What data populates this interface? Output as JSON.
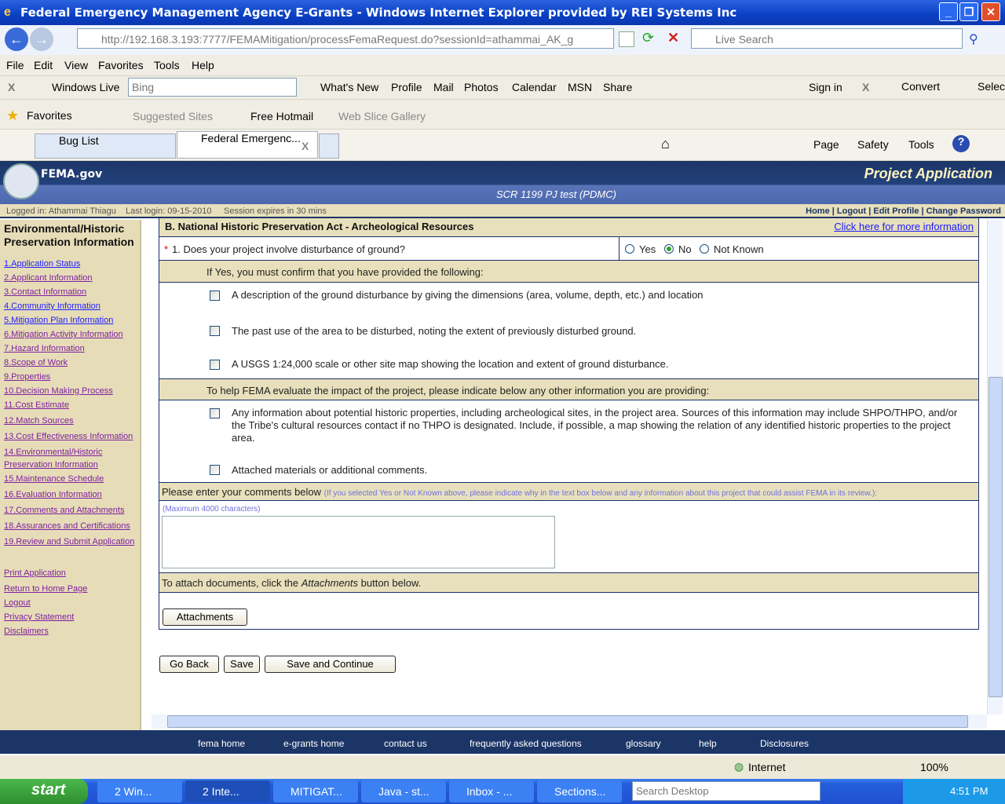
{
  "window": {
    "title": "Federal Emergency Management Agency E-Grants - Windows Internet Explorer provided by REI Systems Inc"
  },
  "address": {
    "url": "http://192.168.3.193:7777/FEMAMitigation/processFemaRequest.do?sessionId=athammai_AK_g",
    "search_placeholder": "Live Search"
  },
  "menu": [
    "File",
    "Edit",
    "View",
    "Favorites",
    "Tools",
    "Help"
  ],
  "live_toolbar": {
    "brand": "Windows Live",
    "search_placeholder": "Bing",
    "items": [
      "What's New",
      "Profile",
      "Mail",
      "Photos",
      "Calendar",
      "MSN",
      "Share"
    ],
    "sign_in": "Sign in",
    "convert": "Convert",
    "select": "Selec"
  },
  "favorites_bar": {
    "favorites": "Favorites",
    "items": [
      "Suggested Sites",
      "Free Hotmail",
      "Web Slice Gallery"
    ]
  },
  "tabs": [
    {
      "label": "Bug List"
    },
    {
      "label": "Federal Emergenc..."
    }
  ],
  "command_bar": [
    "Page",
    "Safety",
    "Tools"
  ],
  "site": {
    "logo": "FEMA.gov",
    "app_title": "Project Application",
    "subtitle": "SCR 1199 PJ test (PDMC)",
    "login": "Logged in: Athammai Thiagu",
    "last_login": "Last login: 09-15-2010",
    "session": "Session expires in 30 mins",
    "top_links": [
      "Home",
      "Logout",
      "Edit Profile",
      "Change Password"
    ]
  },
  "sidebar": {
    "title": "Environmental/Historic Preservation Information",
    "items": [
      "1.Application Status",
      "2.Applicant Information",
      "3.Contact Information",
      "4.Community Information",
      "5.Mitigation Plan Information",
      "6.Mitigation Activity Information",
      "7.Hazard Information",
      "8.Scope of Work",
      "9.Properties",
      "10.Decision Making Process",
      "11.Cost Estimate",
      "12.Match Sources",
      "13.Cost Effectiveness Information",
      "14.Environmental/Historic Preservation Information",
      "15.Maintenance Schedule",
      "16.Evaluation Information",
      "17.Comments and Attachments",
      "18.Assurances and Certifications",
      "19.Review and Submit Application"
    ],
    "extra": [
      "Print Application",
      "Return to Home Page",
      "Logout",
      "Privacy Statement",
      "Disclaimers"
    ]
  },
  "form": {
    "section_title": "B. National Historic Preservation Act - Archeological Resources",
    "more_info": "Click here for more information",
    "q1": {
      "required": "*",
      "label": "1.  Does your project involve disturbance of ground?",
      "options": [
        "Yes",
        "No",
        "Not Known"
      ],
      "selected": "No"
    },
    "confirm_header": "If Yes, you must confirm that you have provided the following:",
    "confirm_items": [
      "A description of the ground disturbance by giving the dimensions (area, volume, depth, etc.) and location",
      "The past use of the area to be disturbed, noting the extent of previously disturbed ground.",
      "A USGS 1:24,000 scale or other site map showing the location and extent of ground disturbance."
    ],
    "other_header": "To help FEMA evaluate the impact of the project, please indicate below any other information you are providing:",
    "other_items": [
      "Any information about potential historic properties, including archeological sites, in the project area. Sources of this information may include SHPO/THPO, and/or the Tribe's cultural resources contact if no THPO is designated. Include, if possible, a map showing the relation of any identified historic properties to the project area.",
      "Attached materials or additional comments."
    ],
    "comments_label": "Please enter your comments below",
    "comments_hint": "(If you selected Yes or Not Known above, please indicate why in the text box below and any information about this project that could assist FEMA in its review.):",
    "max_chars": "(Maximum 4000 characters)",
    "comments_value": "",
    "attach_prefix": "To attach documents, click the ",
    "attach_em": "Attachments",
    "attach_suffix": " button below.",
    "attachments_button": "Attachments",
    "go_back": "Go Back",
    "save": "Save",
    "save_continue": "Save and Continue"
  },
  "footer_links": [
    "fema home",
    "e-grants home",
    "contact us",
    "frequently asked questions",
    "glossary",
    "help",
    "Disclosures"
  ],
  "statusbar": {
    "zone": "Internet",
    "zoom": "100%"
  },
  "taskbar": {
    "start": "start",
    "tasks": [
      "2 Win...",
      "2 Inte...",
      "MITIGAT...",
      "Java - st...",
      "Inbox - ...",
      "Sections..."
    ],
    "search_placeholder": "Search Desktop",
    "clock": "4:51 PM"
  }
}
